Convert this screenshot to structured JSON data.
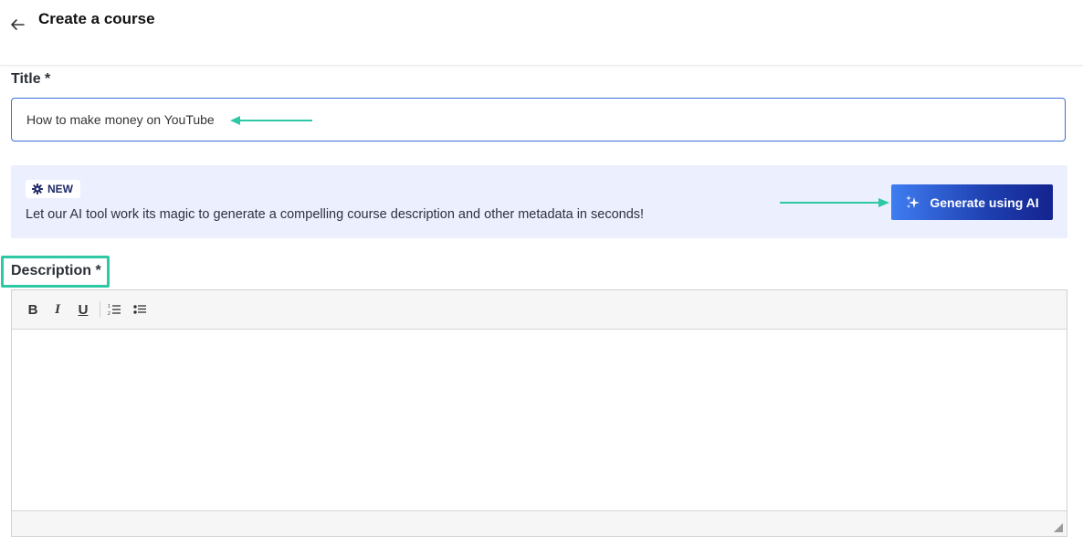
{
  "header": {
    "title": "Create a course",
    "back_icon": "arrow-left-icon"
  },
  "form": {
    "title_label": "Title *",
    "title_value": "How to make money on YouTube",
    "description_label": "Description *"
  },
  "ai_banner": {
    "badge": "NEW",
    "badge_icon": "gear-icon",
    "text": "Let our AI tool work its magic to generate a compelling course description and other metadata in seconds!",
    "button_label": "Generate using AI",
    "button_icon": "sparkles-icon"
  },
  "editor": {
    "toolbar": [
      {
        "name": "bold",
        "glyph": "B"
      },
      {
        "name": "italic",
        "glyph": "I"
      },
      {
        "name": "underline",
        "glyph": "U"
      },
      {
        "name": "ordered-list",
        "glyph": ""
      },
      {
        "name": "bullet-list",
        "glyph": ""
      }
    ],
    "content": ""
  },
  "colors": {
    "accent_teal": "#2ec8a6",
    "banner_bg": "#eceffe",
    "button_gradient_start": "#3f7df1",
    "button_gradient_end": "#14238f",
    "input_border": "#3b6fd6"
  }
}
